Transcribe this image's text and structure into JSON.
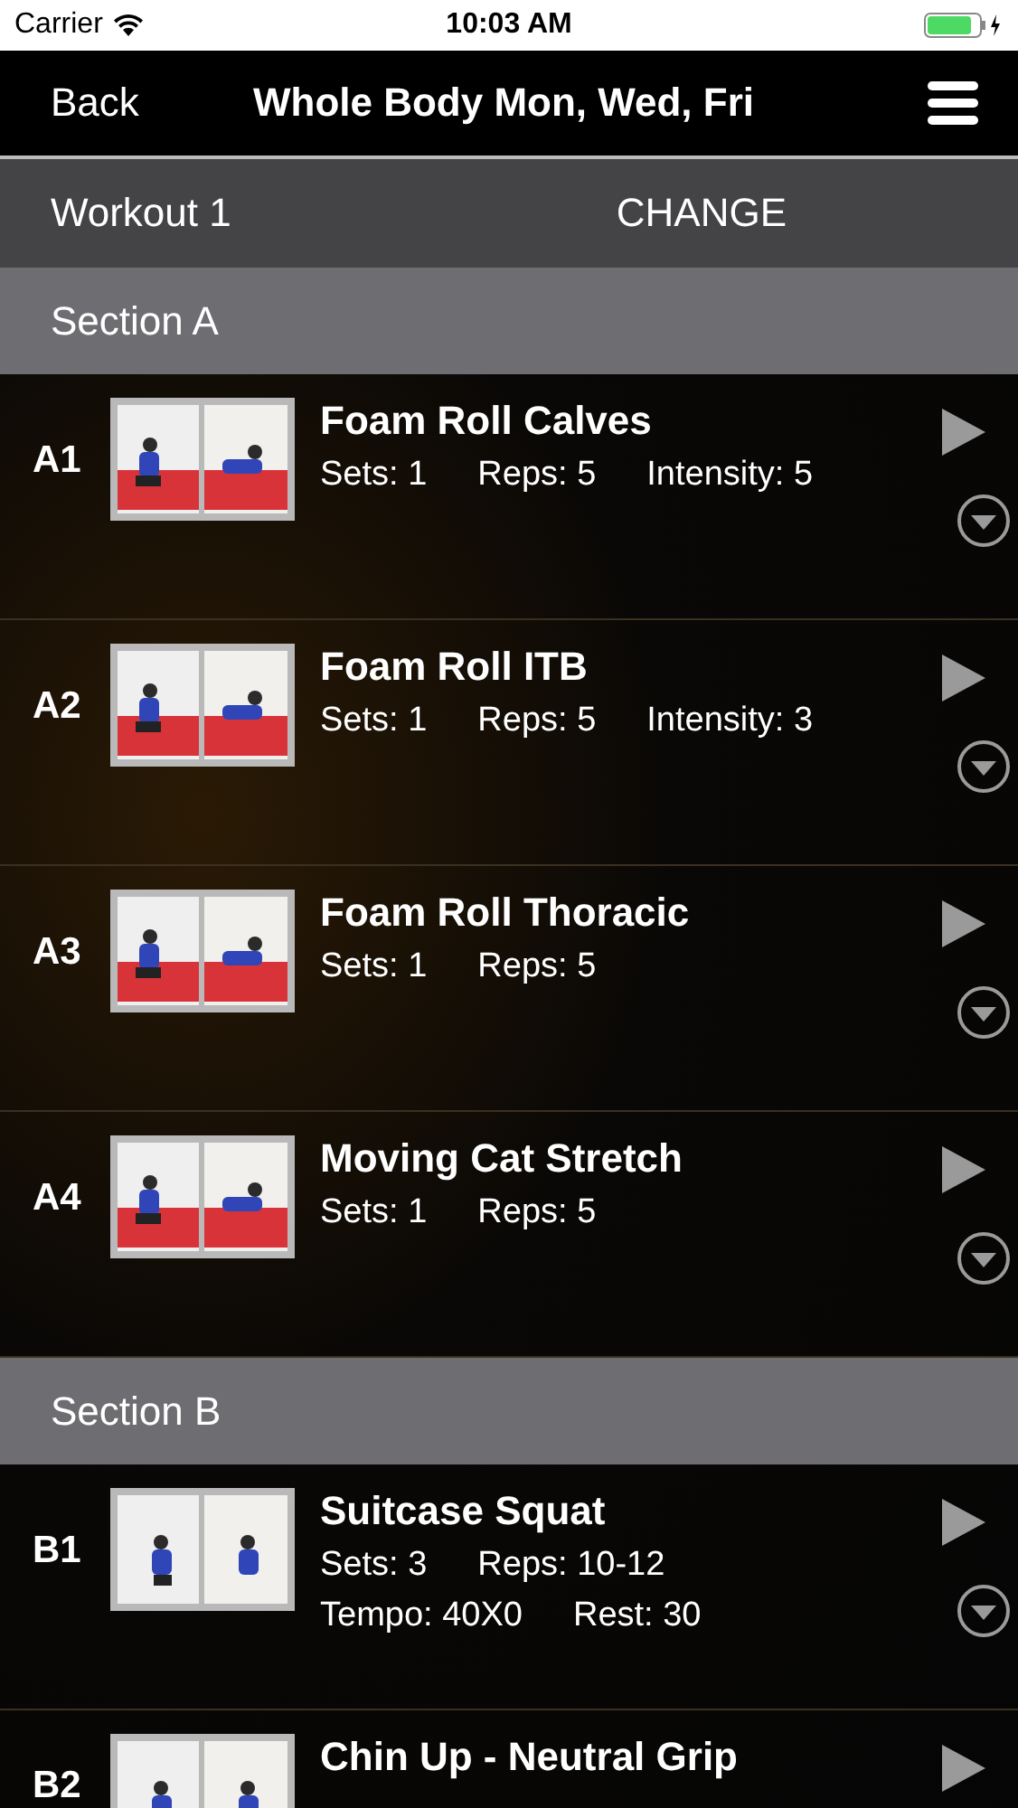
{
  "status_bar": {
    "carrier": "Carrier",
    "time": "10:03 AM"
  },
  "nav": {
    "back": "Back",
    "title": "Whole Body Mon, Wed, Fri"
  },
  "workout": {
    "name": "Workout 1",
    "action": "CHANGE"
  },
  "sections": [
    {
      "title": "Section A",
      "exercises": [
        {
          "code": "A1",
          "title": "Foam Roll Calves",
          "kind": "picture",
          "stats": [
            [
              "Sets: 1",
              "Reps: 5",
              "Intensity: 5"
            ]
          ]
        },
        {
          "code": "A2",
          "title": "Foam Roll ITB",
          "kind": "picture",
          "stats": [
            [
              "Sets: 1",
              "Reps: 5",
              "Intensity: 3"
            ]
          ]
        },
        {
          "code": "A3",
          "title": "Foam Roll Thoracic",
          "kind": "picture",
          "stats": [
            [
              "Sets: 1",
              "Reps: 5"
            ]
          ]
        },
        {
          "code": "A4",
          "title": "Moving Cat Stretch",
          "kind": "picture",
          "stats": [
            [
              "Sets: 1",
              "Reps: 5"
            ]
          ]
        }
      ]
    },
    {
      "title": "Section B",
      "exercises": [
        {
          "code": "B1",
          "title": "Suitcase Squat",
          "kind": "picture",
          "stats": [
            [
              "Sets: 3",
              "Reps: 10-12"
            ],
            [
              "Tempo: 40X0",
              "Rest: 30"
            ]
          ]
        },
        {
          "code": "B2",
          "title": "Chin Up - Neutral Grip",
          "kind": "picture"
        }
      ]
    }
  ]
}
